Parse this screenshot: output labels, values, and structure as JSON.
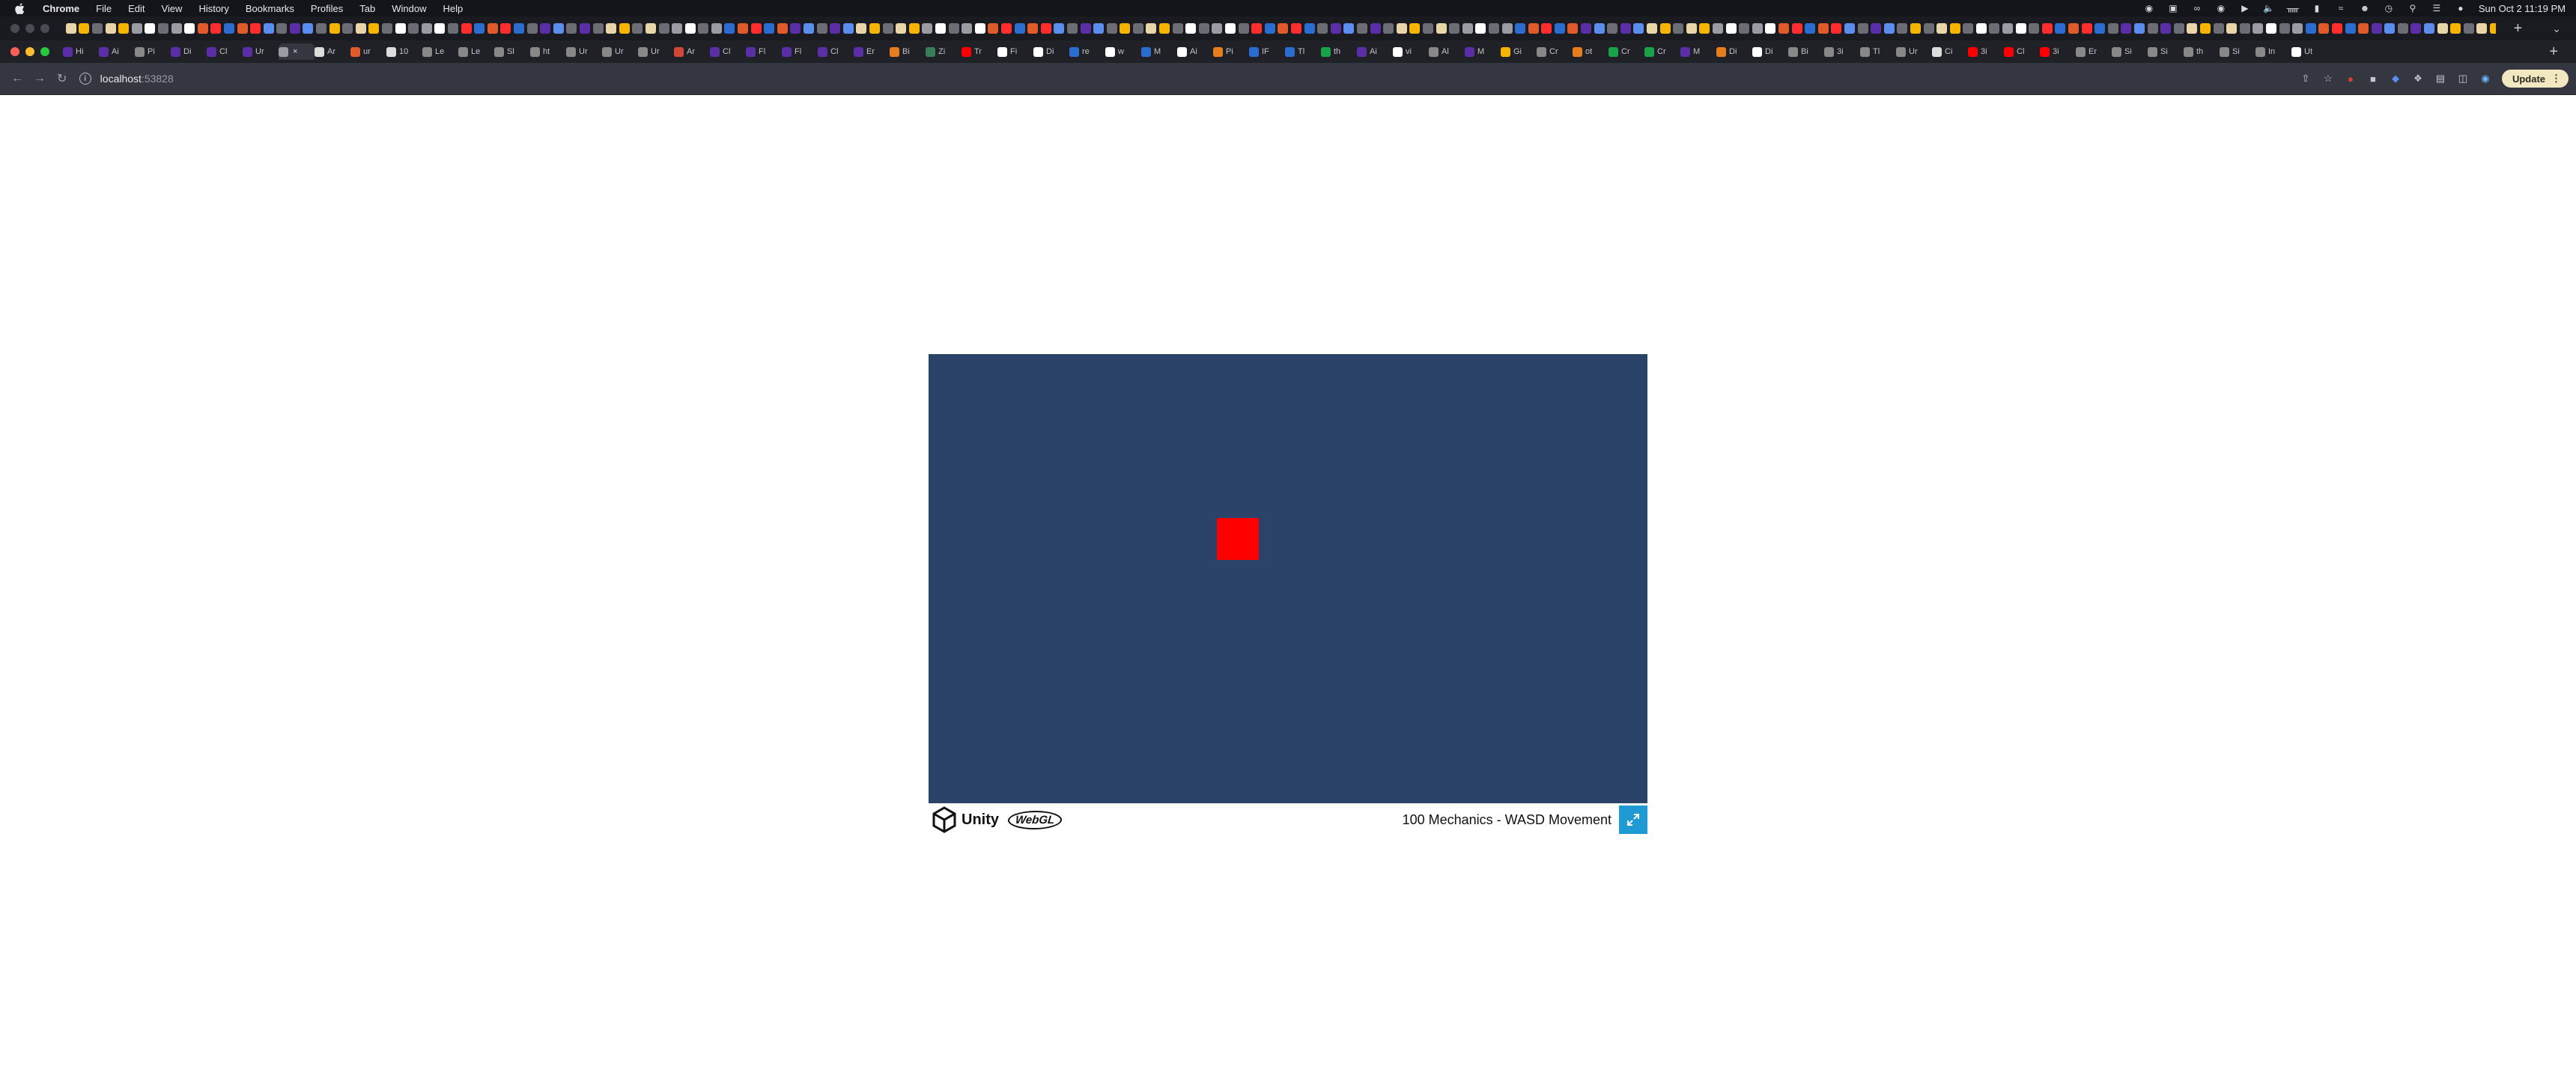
{
  "menubar": {
    "app_name": "Chrome",
    "items": [
      "File",
      "Edit",
      "View",
      "History",
      "Bookmarks",
      "Profiles",
      "Tab",
      "Window",
      "Help"
    ],
    "clock": "Sun Oct 2  11:19 PM"
  },
  "tabstrip2": {
    "tabs": [
      {
        "label": "Hi",
        "color": "#5a2ea6"
      },
      {
        "label": "Ai",
        "color": "#5a2ea6"
      },
      {
        "label": "Pi",
        "color": "#888888"
      },
      {
        "label": "Di",
        "color": "#5a2ea6"
      },
      {
        "label": "Cl",
        "color": "#5a2ea6"
      },
      {
        "label": "Ur",
        "color": "#5a2ea6"
      },
      {
        "label": "",
        "color": "#9a9ba3"
      },
      {
        "label": "Ar",
        "color": "#dddddd"
      },
      {
        "label": "ur",
        "color": "#e05a2a"
      },
      {
        "label": "10",
        "color": "#dddddd"
      },
      {
        "label": "Le",
        "color": "#888888"
      },
      {
        "label": "Le",
        "color": "#888888"
      },
      {
        "label": "Sl",
        "color": "#888888"
      },
      {
        "label": "ht",
        "color": "#888888"
      },
      {
        "label": "Ur",
        "color": "#888888"
      },
      {
        "label": "Ur",
        "color": "#888888"
      },
      {
        "label": "Ur",
        "color": "#888888"
      },
      {
        "label": "Ar",
        "color": "#d44638"
      },
      {
        "label": "Cl",
        "color": "#5a2ea6"
      },
      {
        "label": "Fl",
        "color": "#5a2ea6"
      },
      {
        "label": "Fl",
        "color": "#5a2ea6"
      },
      {
        "label": "Cl",
        "color": "#5a2ea6"
      },
      {
        "label": "Er",
        "color": "#5a2ea6"
      },
      {
        "label": "Bi",
        "color": "#e87d1e"
      },
      {
        "label": "Zi",
        "color": "#3a7d5a"
      },
      {
        "label": "Tr",
        "color": "#ff0000"
      },
      {
        "label": "Fi",
        "color": "#ffffff"
      },
      {
        "label": "Di",
        "color": "#ffffff"
      },
      {
        "label": "re",
        "color": "#2b6cd1"
      },
      {
        "label": "w",
        "color": "#ffffff"
      },
      {
        "label": "M",
        "color": "#2b6cd1"
      },
      {
        "label": "Ai",
        "color": "#ffffff"
      },
      {
        "label": "Pi",
        "color": "#e87d1e"
      },
      {
        "label": "IF",
        "color": "#2b6cd1"
      },
      {
        "label": "Tl",
        "color": "#2b6cd1"
      },
      {
        "label": "th",
        "color": "#17a34a"
      },
      {
        "label": "Ai",
        "color": "#5a2ea6"
      },
      {
        "label": "vi",
        "color": "#ffffff"
      },
      {
        "label": "Al",
        "color": "#888888"
      },
      {
        "label": "M",
        "color": "#5a2ea6"
      },
      {
        "label": "Gi",
        "color": "#f4b400"
      },
      {
        "label": "Cr",
        "color": "#888888"
      },
      {
        "label": "ot",
        "color": "#e87d1e"
      },
      {
        "label": "Cr",
        "color": "#17a34a"
      },
      {
        "label": "Cr",
        "color": "#17a34a"
      },
      {
        "label": "M",
        "color": "#5a2ea6"
      },
      {
        "label": "Di",
        "color": "#e87d1e"
      },
      {
        "label": "Di",
        "color": "#ffffff"
      },
      {
        "label": "Bi",
        "color": "#888888"
      },
      {
        "label": "3i",
        "color": "#888888"
      },
      {
        "label": "Tl",
        "color": "#888888"
      },
      {
        "label": "Ur",
        "color": "#888888"
      },
      {
        "label": "Ci",
        "color": "#dddddd"
      },
      {
        "label": "3i",
        "color": "#ff0000"
      },
      {
        "label": "Cl",
        "color": "#ff0000"
      },
      {
        "label": "3i",
        "color": "#ff0000"
      },
      {
        "label": "Er",
        "color": "#888888"
      },
      {
        "label": "Si",
        "color": "#888888"
      },
      {
        "label": "Si",
        "color": "#888888"
      },
      {
        "label": "th",
        "color": "#888888"
      },
      {
        "label": "Si",
        "color": "#888888"
      },
      {
        "label": "In",
        "color": "#888888"
      },
      {
        "label": "Ut",
        "color": "#ffffff"
      }
    ],
    "active_index": 6
  },
  "addressbar": {
    "host": "localhost",
    "port": ":53828",
    "update_label": "Update"
  },
  "unity": {
    "unity_word": "Unity",
    "webgl_word": "WebGL",
    "build_title": "100 Mechanics - WASD Movement"
  },
  "colors": {
    "canvas_bg": "#2b4369",
    "player": "#ff0000",
    "fullscreen_button": "#1f9ad3"
  }
}
